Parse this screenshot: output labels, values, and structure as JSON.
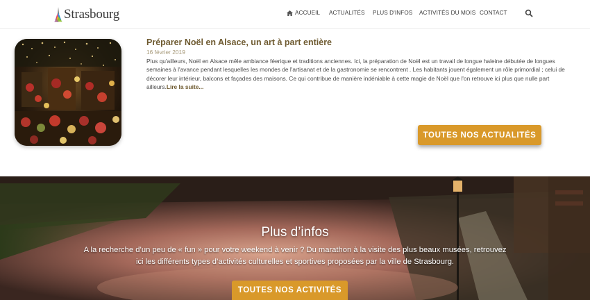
{
  "header": {
    "logo_text": "Strasbourg",
    "nav": [
      {
        "label": "ACCUEIL"
      },
      {
        "label": "ACTUALITÉS"
      },
      {
        "label": "PLUS D'INFOS"
      },
      {
        "label": "ACTIVITÉS DU MOIS"
      },
      {
        "label": "CONTACT"
      }
    ],
    "icons": {
      "home": "home-icon",
      "search": "search-icon"
    }
  },
  "article": {
    "title": "Préparer Noël en Alsace, un art à part entière",
    "date": "16 février 2019",
    "body": "Plus qu'ailleurs, Noël en Alsace mêle ambiance féerique et traditions anciennes. Ici, la préparation de Noël est un travail de longue haleine débutée de longues semaines à l'avance pendant lesquelles les mondes de l'artisanat et de la gastronomie se rencontrent . Les habitants jouent également un rôle primordial ; celui de décorer leur intérieur, balcons et façades des maisons. Ce qui contribue de manière indéniable à cette magie de Noël que l'on retrouve ici plus que nulle part ailleurs.",
    "read_more": "Lire la suite..."
  },
  "news_button": "TOUTES NOS ACTUALITÉS",
  "hero": {
    "title": "Plus d’infos",
    "text_line1": "A la recherche d’un peu de « fun » pour votre weekend à venir ? Du marathon à la visite des plus beaux musées, retrouvez",
    "text_line2": "ici les différents types d’activités culturelles et sportives proposées par la ville de Strasbourg.",
    "button": "TOUTES NOS ACTIVITÉS"
  },
  "colors": {
    "accent": "#d9992a",
    "title_brown": "#6e5a30",
    "date": "#a79a7a"
  }
}
